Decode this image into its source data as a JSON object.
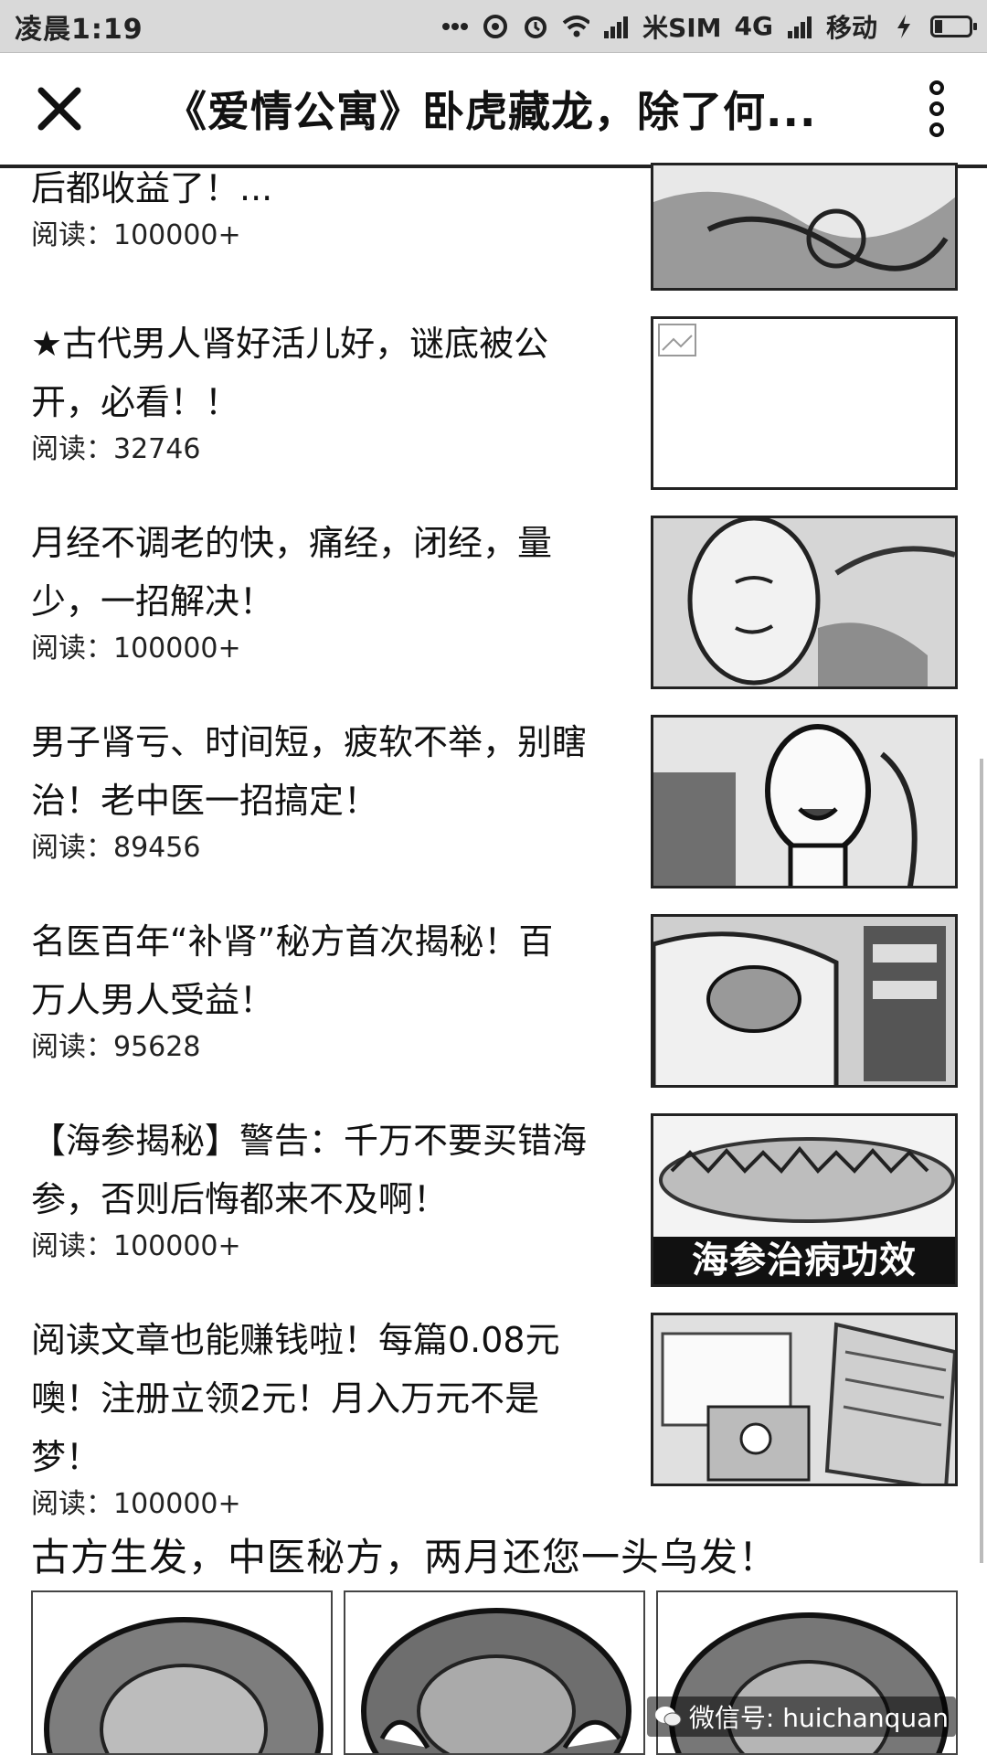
{
  "status_bar": {
    "time": "凌晨1:19",
    "carrier_sim": "米SIM",
    "network": "4G",
    "carrier": "移动"
  },
  "header": {
    "title": "《爱情公寓》卧虎藏龙，除了何..."
  },
  "articles": [
    {
      "title_lines": [
        "后都收益了！..."
      ],
      "reads_label": "阅读：100000+"
    },
    {
      "title_lines": [
        "★古代男人肾好活儿好，谜底被公",
        "开，必看！！"
      ],
      "reads_label": "阅读：32746"
    },
    {
      "title_lines": [
        "月经不调老的快，痛经，闭经，量",
        "少，一招解决！"
      ],
      "reads_label": "阅读：100000+"
    },
    {
      "title_lines": [
        "男子肾亏、时间短，疲软不举，别瞎",
        "治！老中医一招搞定！"
      ],
      "reads_label": "阅读：89456"
    },
    {
      "title_lines": [
        "名医百年“补肾”秘方首次揭秘！百",
        "万人男人受益！"
      ],
      "reads_label": "阅读：95628"
    },
    {
      "title_lines": [
        "【海参揭秘】警告：千万不要买错海",
        "参，否则后悔都来不及啊！"
      ],
      "reads_label": "阅读：100000+",
      "thumb_caption": "海参治病功效"
    },
    {
      "title_lines": [
        "阅读文章也能赚钱啦！每篇0.08元",
        "噢！注册立领2元！月入万元不是",
        "梦！"
      ],
      "reads_label": "阅读：100000+"
    }
  ],
  "promo": {
    "title": "古方生发，中医秘方，两月还您一头乌发！"
  },
  "watermark": "微信号: huichanquan"
}
